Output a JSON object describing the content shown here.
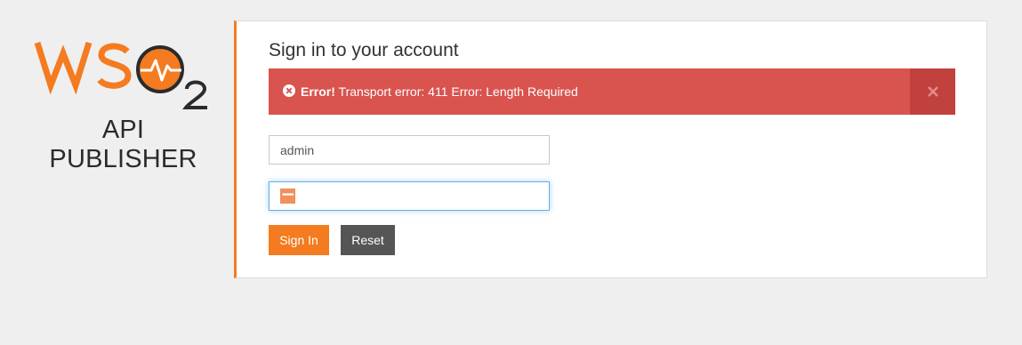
{
  "branding": {
    "logo_text": "WSO2",
    "product_name": "API PUBLISHER",
    "colors": {
      "orange": "#f47b20",
      "dark": "#2b2b2b"
    }
  },
  "login": {
    "heading": "Sign in to your account",
    "alert": {
      "strong": "Error!",
      "message": " Transport error: 411 Error: Length Required",
      "icon": "error-circle-icon",
      "close_icon": "close-icon",
      "color": "#d9534f"
    },
    "username": {
      "value": "admin"
    },
    "password": {
      "masked": "•••••"
    },
    "buttons": {
      "sign_in": "Sign In",
      "reset": "Reset"
    }
  }
}
